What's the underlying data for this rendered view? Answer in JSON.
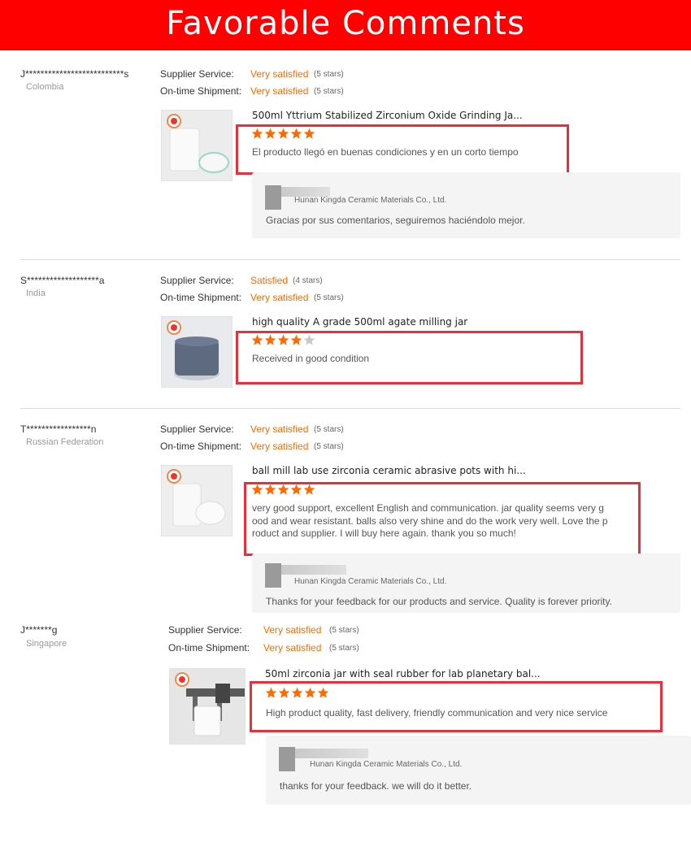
{
  "banner": {
    "title": "Favorable Comments"
  },
  "labels": {
    "supplier_service": "Supplier Service:",
    "ontime_shipment": "On-time Shipment:"
  },
  "reviews": [
    {
      "buyer": "J**************************s",
      "country": "Colombia",
      "supplier_service": {
        "value": "Very satisfied",
        "stars": "(5 stars)"
      },
      "ontime_shipment": {
        "value": "Very satisfied",
        "stars": "(5 stars)"
      },
      "product_title": "500ml Yttrium Stabilized Zirconium Oxide Grinding Ja...",
      "rating": 5,
      "comment": "El producto llegó en buenas condiciones y en un corto tiempo",
      "reply": {
        "supplier": "Hunan Kingda Ceramic Materials Co., Ltd.",
        "text": "Gracias por sus comentarios, seguiremos haciéndolo mejor."
      }
    },
    {
      "buyer": "S*******************a",
      "country": "India",
      "supplier_service": {
        "value": "Satisfied",
        "stars": "(4 stars)"
      },
      "ontime_shipment": {
        "value": "Very satisfied",
        "stars": "(5 stars)"
      },
      "product_title": "high quality A grade 500ml agate milling jar",
      "rating": 4,
      "comment": "Received in good condition"
    },
    {
      "buyer": "T*****************n",
      "country": "Russian Federation",
      "supplier_service": {
        "value": "Very satisfied",
        "stars": "(5 stars)"
      },
      "ontime_shipment": {
        "value": "Very satisfied",
        "stars": "(5 stars)"
      },
      "product_title": "ball mill lab use zirconia ceramic abrasive pots with hi...",
      "rating": 5,
      "comment_lines": [
        "very good support, excellent English and communication. jar quality seems very g",
        "ood and wear resistant. balls also very shine and do the work very well. Love the p",
        "roduct and supplier. I will buy here again. thank you so much!"
      ],
      "reply": {
        "supplier": "Hunan Kingda Ceramic Materials Co., Ltd.",
        "text": "Thanks for your feedback for our products and service. Quality is forever priority."
      }
    },
    {
      "buyer": "J*******g",
      "country": "Singapore",
      "supplier_service": {
        "value": "Very satisfied",
        "stars": "(5 stars)"
      },
      "ontime_shipment": {
        "value": "Very satisfied",
        "stars": "(5 stars)"
      },
      "product_title": "50ml zirconia jar with seal rubber for lab planetary bal...",
      "rating": 5,
      "comment": "High product quality, fast delivery, friendly communication and very nice service",
      "reply": {
        "supplier": "Hunan Kingda Ceramic Materials Co., Ltd.",
        "text": "thanks for your feedback. we will do it better."
      }
    }
  ],
  "colors": {
    "banner": "#ff0000",
    "accent": "#ff6a00",
    "highlight_box": "#e8303a",
    "star_filled": "#ff6a00",
    "star_empty": "#c8c8c8"
  },
  "icons": {
    "star": "star-icon",
    "logo": "brand-logo-icon"
  }
}
